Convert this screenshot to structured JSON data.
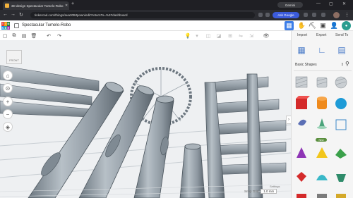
{
  "browser": {
    "tab_title": "3D design Spectacular Tumelo-Robo",
    "url": "tinkercad.com/things/aua30tMpown/edit?returnTo=%2Fdashboard",
    "gemini_label": "Gemini",
    "ask_google_label": "Ask Google"
  },
  "app": {
    "logo_letters": [
      "T",
      "I",
      "N",
      "K",
      "E",
      "R"
    ],
    "project_name": "Spectacular Tumelo-Robo"
  },
  "panel": {
    "actions": [
      "Import",
      "Export",
      "Send To"
    ],
    "shapes_category": "Basic Shapes",
    "new_badge": "New"
  },
  "viewport": {
    "viewcube_label": "FRONT",
    "snap_label": "Snap Grid",
    "snap_value": "1.0 mm",
    "settings_label": "Settings"
  },
  "colors": {
    "accent": "#3d7ee8",
    "logo": [
      "#e53935",
      "#f39c12",
      "#2e7d32",
      "#1e88e5",
      "#26a69a",
      "#8e24aa"
    ]
  }
}
